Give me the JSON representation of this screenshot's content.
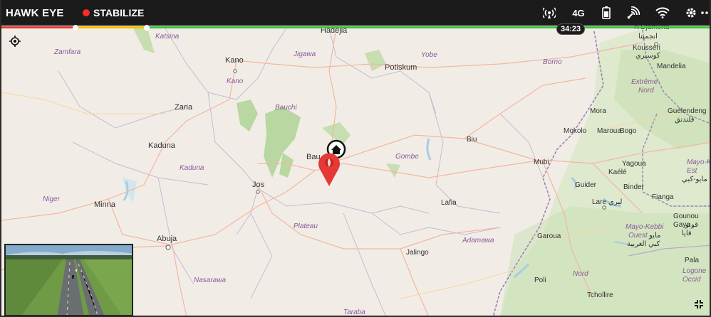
{
  "app": {
    "title": "HAWK EYE",
    "mode_label": "STABILIZE",
    "mode_dot_color": "#ff2a2a"
  },
  "status": {
    "icons": [
      "telemetry-icon",
      "lte-icon",
      "battery-icon",
      "rc-signal-icon",
      "wifi-icon",
      "settings-icon",
      "more-icon"
    ],
    "lte_label": "4G"
  },
  "timeline": {
    "elapsed_label": "34:23",
    "colors": {
      "red": "#e53935",
      "yellow": "#f2c000",
      "green": "#3fbf3f"
    }
  },
  "map": {
    "places": {
      "hadejia": "Hadejia",
      "katsina": "Katsina",
      "zamfara": "Zamfara",
      "kano_city": "Kano",
      "kano_state": "Kano",
      "jigawa": "Jigawa",
      "yobe": "Yobe",
      "potiskum": "Potiskum",
      "borno": "Borno",
      "ndjamena": "N'Djamena",
      "ndjamena_ar": "انجمينا",
      "kousseri": "Kousséri",
      "kousseri_ar": "كوسيري",
      "mandelia": "Mandelia",
      "extreme_nord": "Extrême-",
      "extreme_nord2": "Nord",
      "zaria": "Zaria",
      "bauchi_state": "Bauchi",
      "kaduna_city": "Kaduna",
      "kaduna_state": "Kaduna",
      "bauchi_city": "Bau",
      "gombe": "Gombe",
      "biu": "Biu",
      "mora": "Mora",
      "mokolo": "Mokolo",
      "bogo": "Bogo",
      "maroua": "Maroua",
      "guelendeng": "Guélendeng",
      "guelendeng_ar": "قلندنق",
      "mubi": "Mubi",
      "yagoua": "Yagoua",
      "mayo_kebbi_est": "Mayo-K",
      "mayo_kebbi_est2": "Est",
      "mayo_kebbi_est_ar": "مايو-كبي",
      "kaele": "Kaélé",
      "niger": "Niger",
      "jos": "Jos",
      "guider": "Guider",
      "binder": "Binder",
      "lare": "Lare",
      "lare_ar": "ليري",
      "fianga": "Fianga",
      "minna": "Minna",
      "lafia": "Lafia",
      "gounou": "Gounou",
      "gounou2": "Gaya",
      "gounou_ar": "قونو",
      "gounou_ar2": "قايا",
      "plateau": "Plateau",
      "mayo_kebbi_ouest": "Mayo-Kebbi",
      "mayo_kebbi_ouest2": "Ouest",
      "mayo_kebbi_ouest_ar": "مايو",
      "mayo_kebbi_ouest_ar2": "كبي الغربية",
      "abuja": "Abuja",
      "garoua": "Garoua",
      "adamawa": "Adamawa",
      "jalingo": "Jalingo",
      "nasarawa": "Nasarawa",
      "nord": "Nord",
      "logone": "Logone",
      "pala": "Pala",
      "poli": "Poli",
      "tcholliré": "Tchollire",
      "taraba": "Taraba",
      "occidental": "Occid"
    }
  }
}
